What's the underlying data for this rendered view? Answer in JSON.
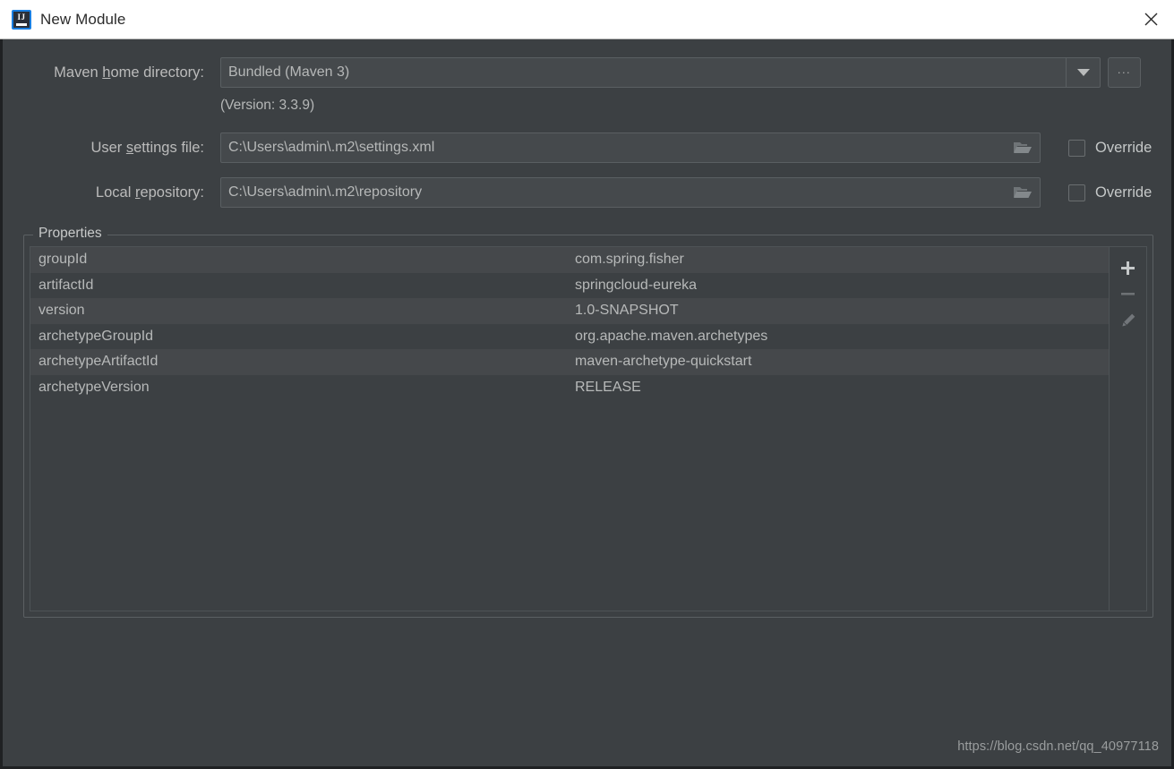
{
  "window": {
    "title": "New Module",
    "app_icon": "intellij-idea-icon",
    "icon_letters": "IJ",
    "close_icon": "close-icon"
  },
  "form": {
    "maven_home": {
      "label_before": "Maven ",
      "label_mnemonic": "h",
      "label_after": "ome directory:",
      "value": "Bundled (Maven 3)",
      "dropdown_icon": "chevron-down-icon",
      "browse_label": "...",
      "version_text": "(Version: 3.3.9)"
    },
    "user_settings": {
      "label_before": "User ",
      "label_mnemonic": "s",
      "label_after": "ettings file:",
      "value": "C:\\Users\\admin\\.m2\\settings.xml",
      "folder_icon": "folder-icon",
      "override_label": "Override",
      "override_checked": false
    },
    "local_repository": {
      "label_before": "Local ",
      "label_mnemonic": "r",
      "label_after": "epository:",
      "value": "C:\\Users\\admin\\.m2\\repository",
      "folder_icon": "folder-icon",
      "override_label": "Override",
      "override_checked": false
    }
  },
  "properties_panel": {
    "legend": "Properties",
    "rows": [
      {
        "key": "groupId",
        "value": "com.spring.fisher"
      },
      {
        "key": "artifactId",
        "value": "springcloud-eureka"
      },
      {
        "key": "version",
        "value": "1.0-SNAPSHOT"
      },
      {
        "key": "archetypeGroupId",
        "value": "org.apache.maven.archetypes"
      },
      {
        "key": "archetypeArtifactId",
        "value": "maven-archetype-quickstart"
      },
      {
        "key": "archetypeVersion",
        "value": "RELEASE"
      }
    ],
    "toolbar": {
      "add_icon": "plus-icon",
      "remove_icon": "minus-icon",
      "edit_icon": "pencil-icon"
    }
  },
  "watermark": "https://blog.csdn.net/qq_40977118",
  "colors": {
    "dialog_background": "#3c4043",
    "titlebar_background": "#ffffff",
    "field_background": "#45494c",
    "row_alt_background": "#45484b",
    "text": "#b7b9b9",
    "accent_icon_border": "#1a7ee0"
  }
}
